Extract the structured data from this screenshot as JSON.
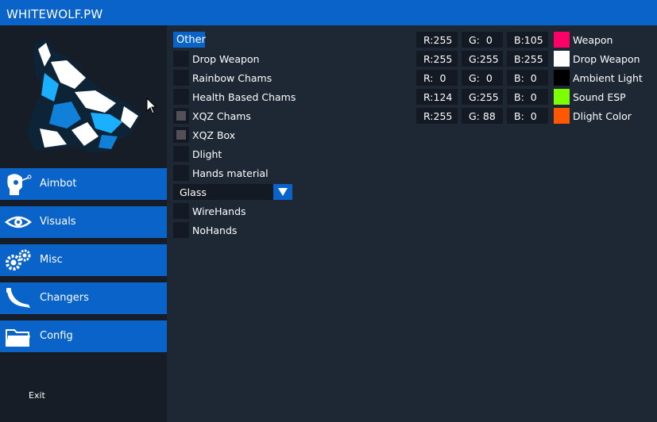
{
  "app": {
    "title": "WHITEWOLF.PW"
  },
  "sidebar": {
    "items": [
      {
        "label": "Aimbot",
        "icon": "aim-head-icon"
      },
      {
        "label": "Visuals",
        "icon": "eye-icon"
      },
      {
        "label": "Misc",
        "icon": "gears-icon"
      },
      {
        "label": "Changers",
        "icon": "knife-icon"
      },
      {
        "label": "Config",
        "icon": "folder-icon"
      }
    ],
    "exit_label": "Exit"
  },
  "content": {
    "tab_label": "Other",
    "options": [
      {
        "label": "Drop Weapon",
        "checked": false
      },
      {
        "label": "Rainbow Chams",
        "checked": false
      },
      {
        "label": "Health Based Chams",
        "checked": false
      },
      {
        "label": "XQZ Chams",
        "checked": true
      },
      {
        "label": "XQZ Box",
        "checked": true
      },
      {
        "label": "Dlight",
        "checked": false
      },
      {
        "label": "Hands material",
        "checked": false
      }
    ],
    "hands_material": {
      "selected": "Glass"
    },
    "options_after": [
      {
        "label": "WireHands",
        "checked": false
      },
      {
        "label": "NoHands",
        "checked": false
      }
    ],
    "colors": [
      {
        "r": "R:255",
        "g": "G:  0",
        "b": "B:105",
        "swatch": "#ff0069",
        "label": "Weapon"
      },
      {
        "r": "R:255",
        "g": "G:255",
        "b": "B:255",
        "swatch": "#ffffff",
        "label": "Drop Weapon"
      },
      {
        "r": "R:  0",
        "g": "G:  0",
        "b": "B:  0",
        "swatch": "#000000",
        "label": "Ambient Light"
      },
      {
        "r": "R:124",
        "g": "G:255",
        "b": "B:  0",
        "swatch": "#7cff00",
        "label": "Sound ESP"
      },
      {
        "r": "R:255",
        "g": "G: 88",
        "b": "B:  0",
        "swatch": "#ff5800",
        "label": "Dlight Color"
      }
    ]
  },
  "theme": {
    "accent": "#0a63c9",
    "background": "#1e2734",
    "sidebar": "#171d27",
    "field": "#141a23"
  }
}
